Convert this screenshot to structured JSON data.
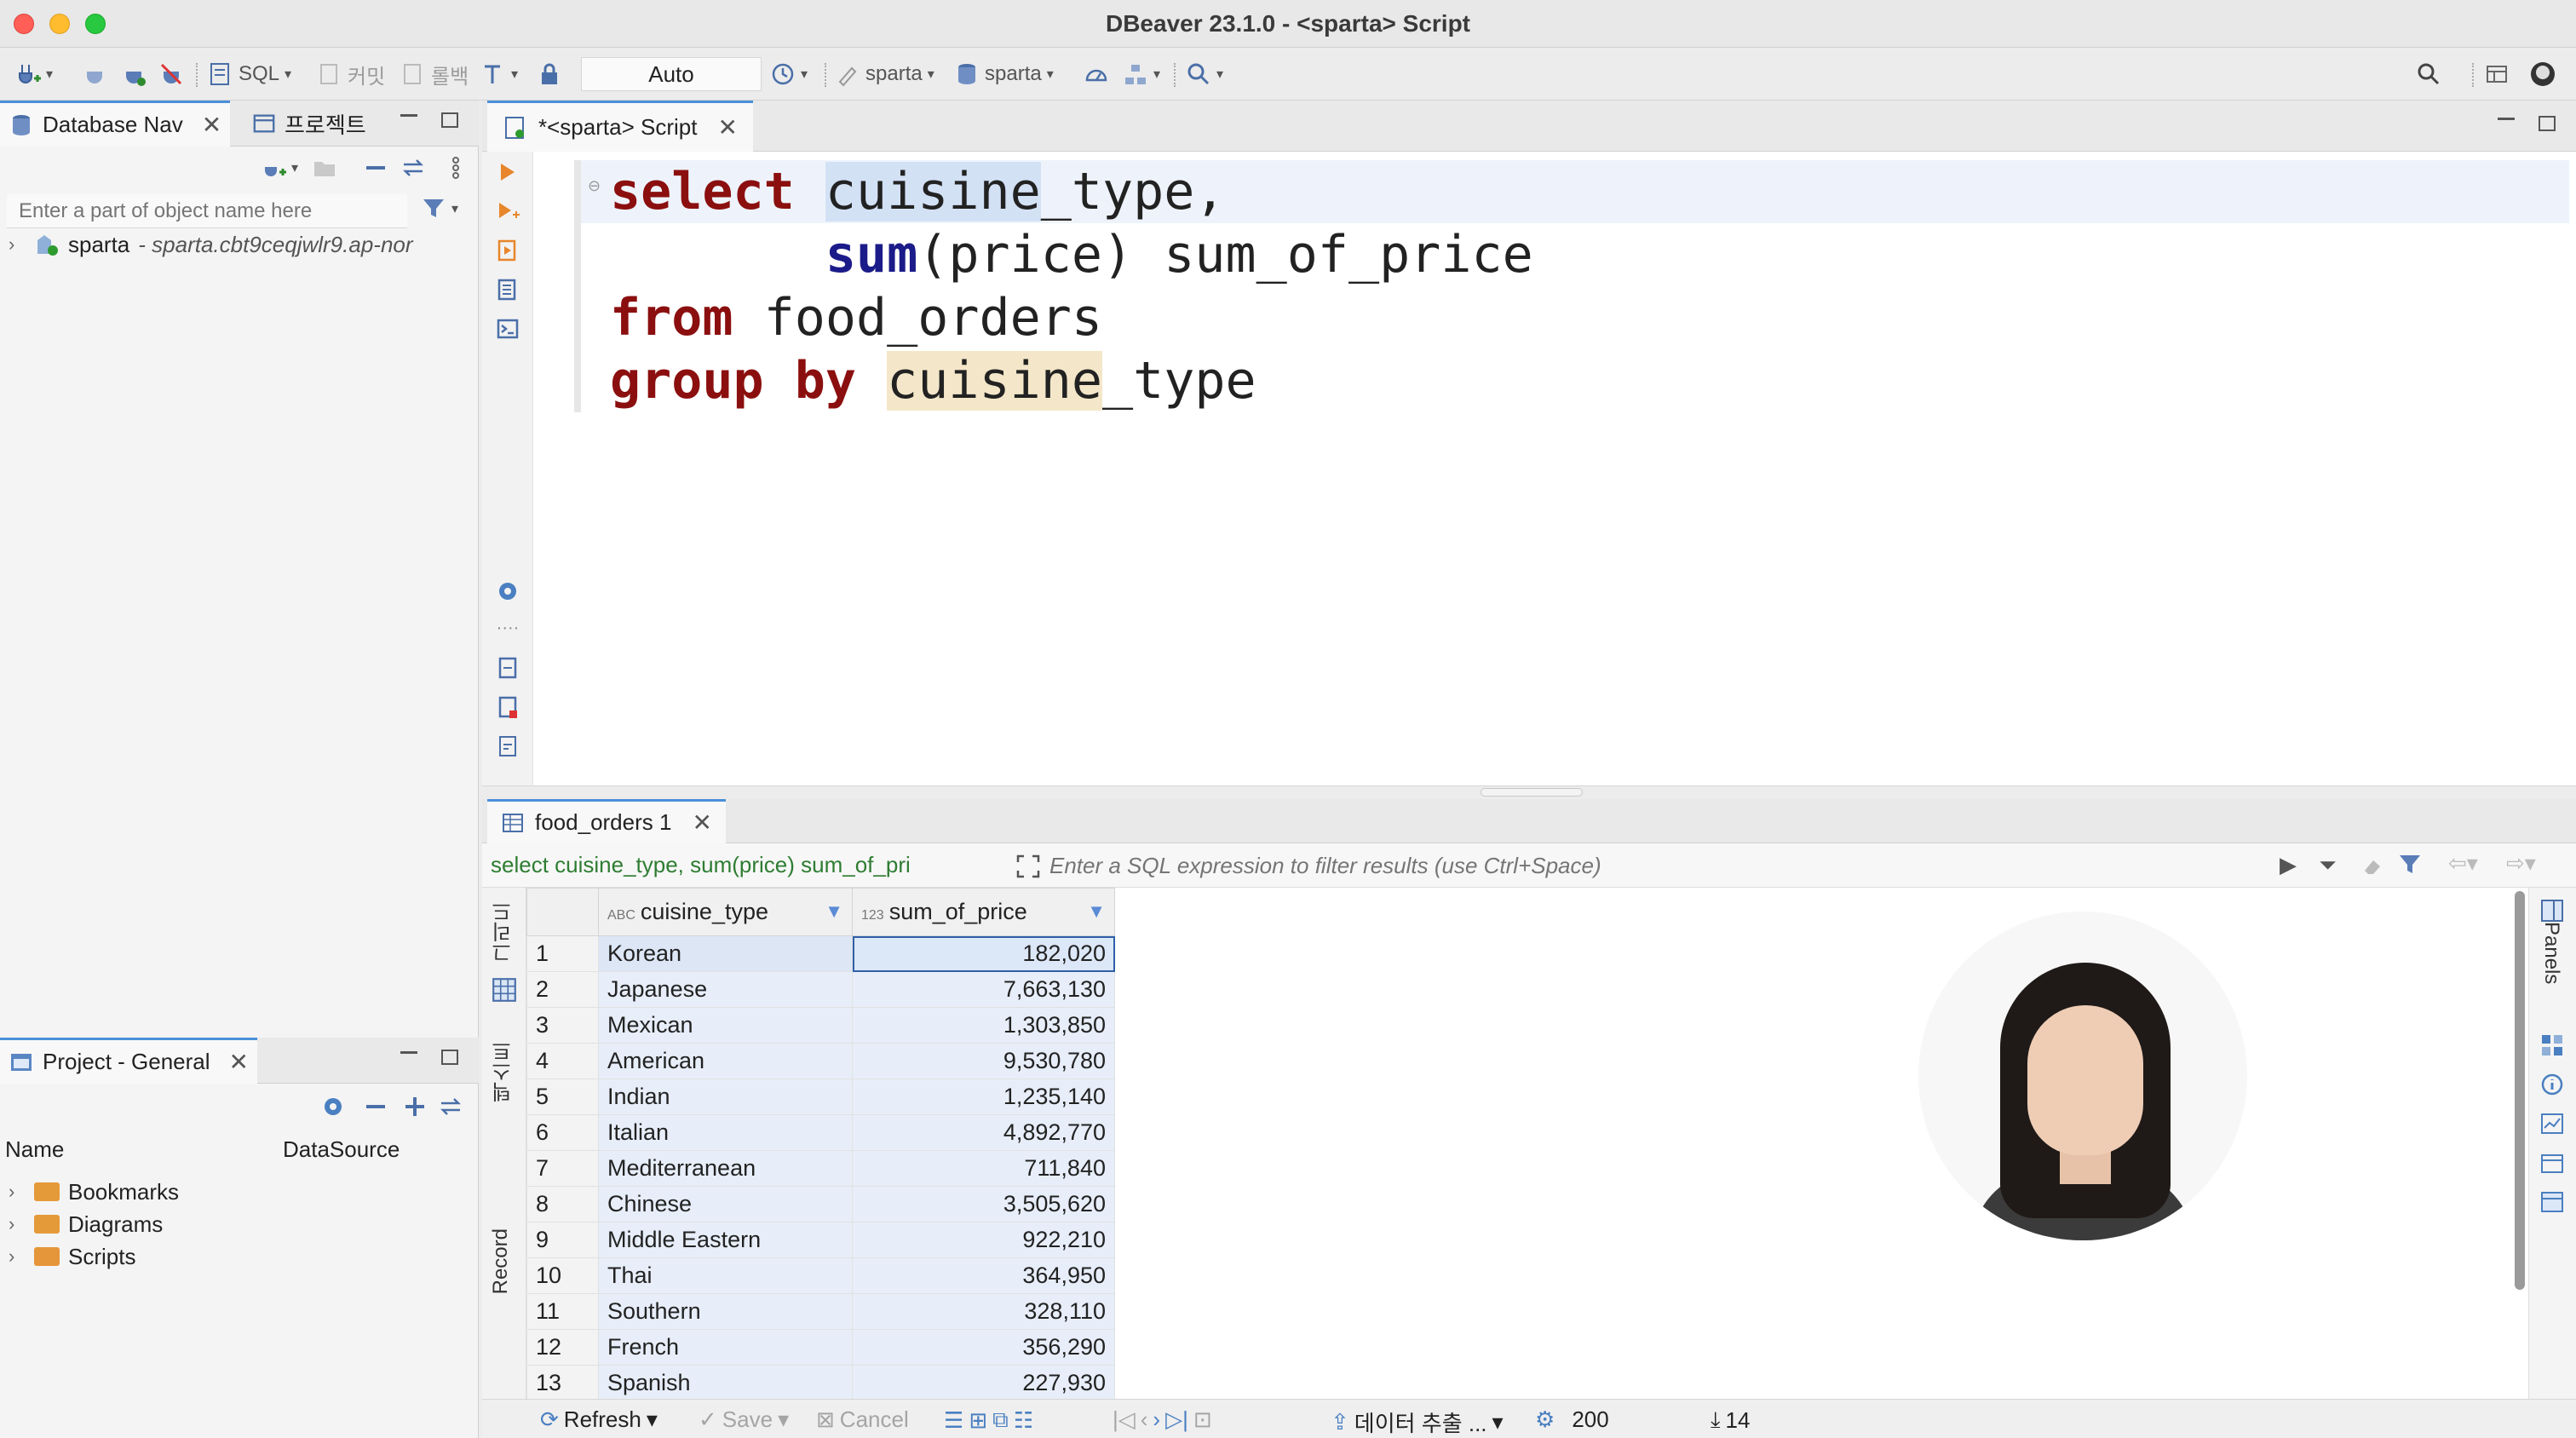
{
  "window": {
    "title": "DBeaver 23.1.0 - <sparta> Script"
  },
  "toolbar": {
    "sql_label": "SQL",
    "commit_label": "커밋",
    "rollback_label": "롤백",
    "transaction_mode": "Auto",
    "schema_1": "sparta",
    "schema_2": "sparta"
  },
  "db_navigator": {
    "tab_label": "Database Nav",
    "project_tab_label": "프로젝트",
    "filter_placeholder": "Enter a part of object name here",
    "connection_name": "sparta",
    "connection_host": "- sparta.cbt9ceqjwlr9.ap-nor"
  },
  "project_panel": {
    "tab_label": "Project - General",
    "col_name": "Name",
    "col_datasource": "DataSource",
    "items": [
      "Bookmarks",
      "Diagrams",
      "Scripts"
    ]
  },
  "editor": {
    "tab_label": "*<sparta> Script",
    "code": {
      "l1_kw": "select",
      "l1_sel": "cuisine",
      "l1_rest": "_type,",
      "l2_fn": "sum",
      "l2_rest": "(price) sum_of_price",
      "l3_kw": "from",
      "l3_rest": " food_orders",
      "l4_kw": "group by",
      "l4_occ": "cuisine",
      "l4_rest": "_type"
    }
  },
  "results": {
    "tab_label": "food_orders 1",
    "query_text": "select cuisine_type, sum(price) sum_of_pri",
    "filter_placeholder": "Enter a SQL expression to filter results (use Ctrl+Space)",
    "side_label_grid": "그리드",
    "side_label_text": "텍스트",
    "side_label_record": "Record",
    "panels_label": "Panels",
    "columns": [
      {
        "type_badge": "ABC",
        "name": "cuisine_type"
      },
      {
        "type_badge": "123",
        "name": "sum_of_price"
      }
    ],
    "rows": [
      {
        "n": "1",
        "cuisine_type": "Korean",
        "sum_of_price": "182,020"
      },
      {
        "n": "2",
        "cuisine_type": "Japanese",
        "sum_of_price": "7,663,130"
      },
      {
        "n": "3",
        "cuisine_type": "Mexican",
        "sum_of_price": "1,303,850"
      },
      {
        "n": "4",
        "cuisine_type": "American",
        "sum_of_price": "9,530,780"
      },
      {
        "n": "5",
        "cuisine_type": "Indian",
        "sum_of_price": "1,235,140"
      },
      {
        "n": "6",
        "cuisine_type": "Italian",
        "sum_of_price": "4,892,770"
      },
      {
        "n": "7",
        "cuisine_type": "Mediterranean",
        "sum_of_price": "711,840"
      },
      {
        "n": "8",
        "cuisine_type": "Chinese",
        "sum_of_price": "3,505,620"
      },
      {
        "n": "9",
        "cuisine_type": "Middle Eastern",
        "sum_of_price": "922,210"
      },
      {
        "n": "10",
        "cuisine_type": "Thai",
        "sum_of_price": "364,950"
      },
      {
        "n": "11",
        "cuisine_type": "Southern",
        "sum_of_price": "328,110"
      },
      {
        "n": "12",
        "cuisine_type": "French",
        "sum_of_price": "356,290"
      },
      {
        "n": "13",
        "cuisine_type": "Spanish",
        "sum_of_price": "227,930"
      }
    ]
  },
  "statusbar": {
    "refresh": "Refresh",
    "save": "Save",
    "cancel": "Cancel",
    "export": "데이터 추출 ...",
    "fetch_size": "200",
    "row_count": "14"
  },
  "colors": {
    "accent": "#4a90d9",
    "keyword": "#8b0f0f",
    "function": "#1b1b8a",
    "selection": "#d3e1f5"
  }
}
